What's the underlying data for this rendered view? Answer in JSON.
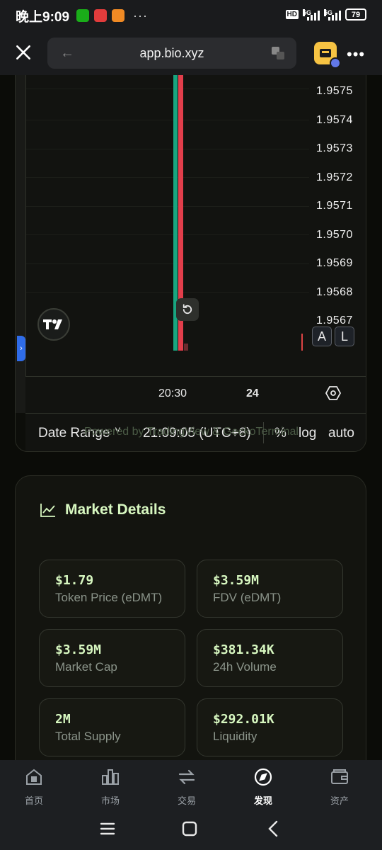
{
  "status_bar": {
    "time": "晚上9:09",
    "more": "···",
    "hd": "HD",
    "network1": "5G",
    "network2": "5G",
    "battery": "79"
  },
  "browser": {
    "back": "←",
    "url": "app.bio.xyz",
    "menu": "•••"
  },
  "chart": {
    "price_labels": [
      "1.9575",
      "1.9574",
      "1.9573",
      "1.9572",
      "1.9571",
      "1.9570",
      "1.9569",
      "1.9568",
      "1.9567"
    ],
    "time_labels": [
      "20:30",
      "24"
    ],
    "scale_buttons": [
      "A",
      "L"
    ],
    "toolbar": {
      "date_range": "Date Range",
      "chevron": "˅",
      "timestamp": "21:09:05 (UTC+8)",
      "percent": "%",
      "log": "log",
      "auto": "auto"
    },
    "powered_by": "Powered by TradingView & GeckoTerminal",
    "side_handle": "›"
  },
  "market": {
    "title": "Market Details",
    "stats": [
      {
        "value": "$1.79",
        "label": "Token Price (eDMT)"
      },
      {
        "value": "$3.59M",
        "label": "FDV (eDMT)"
      },
      {
        "value": "$3.59M",
        "label": "Market Cap"
      },
      {
        "value": "$381.34K",
        "label": "24h Volume"
      },
      {
        "value": "2M",
        "label": "Total Supply"
      },
      {
        "value": "$292.01K",
        "label": "Liquidity"
      }
    ]
  },
  "nav": {
    "items": [
      {
        "label": "首页"
      },
      {
        "label": "市场"
      },
      {
        "label": "交易"
      },
      {
        "label": "发现"
      },
      {
        "label": "资产"
      }
    ],
    "active_index": 3
  },
  "colors": {
    "accent_green": "#d7f7c0",
    "candle_up": "#18a580",
    "candle_down": "#e23e4b"
  }
}
